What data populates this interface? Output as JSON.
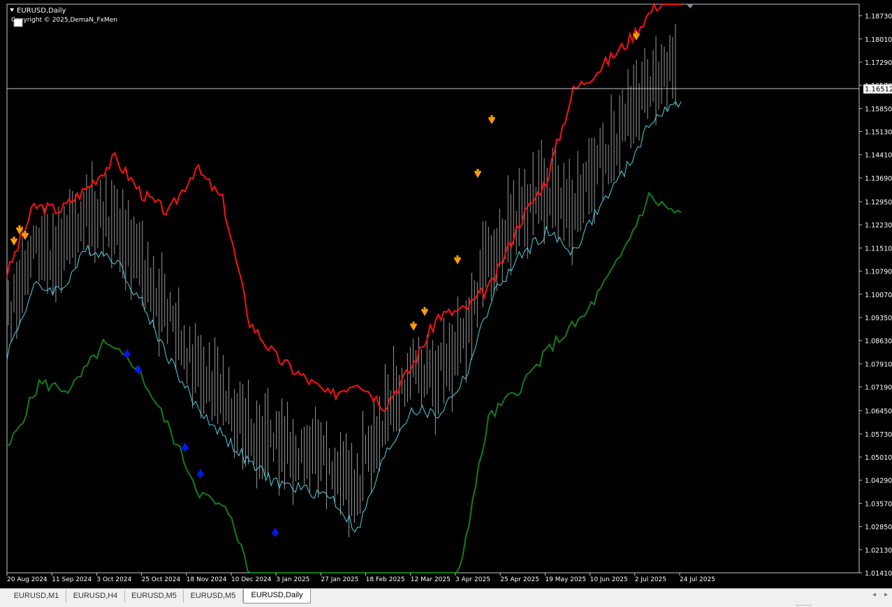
{
  "window": {
    "symbol_label": "EURUSD,Daily",
    "copyright": "Copyright © 2025,DemaN_FxMen"
  },
  "price_axis": {
    "labels": [
      "1.18730",
      "1.18010",
      "1.17290",
      "1.16570",
      "1.15850",
      "1.15130",
      "1.14410",
      "1.13690",
      "1.12950",
      "1.12230",
      "1.11510",
      "1.10790",
      "1.10070",
      "1.09350",
      "1.08630",
      "1.07910",
      "1.07190",
      "1.06450",
      "1.05730",
      "1.05010",
      "1.04290",
      "1.03570",
      "1.02850",
      "1.02130",
      "1.01410"
    ],
    "current_price": "1.16512",
    "min": 1.0141,
    "max": 1.1909
  },
  "time_axis": {
    "labels": [
      "20 Aug 2024",
      "11 Sep 2024",
      "3 Oct 2024",
      "25 Oct 2024",
      "18 Nov 2024",
      "10 Dec 2024",
      "3 Jan 2025",
      "27 Jan 2025",
      "18 Feb 2025",
      "12 Mar 2025",
      "3 Apr 2025",
      "25 Apr 2025",
      "19 May 2025",
      "10 Jun 2025",
      "2 Jul 2025",
      "24 Jul 2025"
    ]
  },
  "chart_data": {
    "type": "line",
    "x_labels": [
      "20 Aug 2024",
      "11 Sep 2024",
      "3 Oct 2024",
      "25 Oct 2024",
      "18 Nov 2024",
      "10 Dec 2024",
      "3 Jan 2025",
      "27 Jan 2025",
      "18 Feb 2025",
      "12 Mar 2025",
      "3 Apr 2025",
      "25 Apr 2025",
      "19 May 2025",
      "10 Jun 2025",
      "2 Jul 2025",
      "24 Jul 2025"
    ],
    "ylim": [
      1.0141,
      1.1909
    ],
    "series": [
      {
        "color": "#ff1010",
        "values": [
          1.107,
          1.128,
          1.127,
          1.134,
          1.143,
          1.132,
          1.126,
          1.14,
          1.13,
          1.092,
          1.081,
          1.075,
          1.069,
          1.074,
          1.066,
          1.078,
          1.094,
          1.096,
          1.104,
          1.123,
          1.136,
          1.164,
          1.171,
          1.179,
          1.19,
          1.195
        ]
      },
      {
        "color": "#4ed4e6",
        "values": [
          1.082,
          1.103,
          1.102,
          1.115,
          1.112,
          1.098,
          1.081,
          1.066,
          1.057,
          1.048,
          1.042,
          1.04,
          1.038,
          1.027,
          1.05,
          1.065,
          1.063,
          1.075,
          1.1,
          1.112,
          1.12,
          1.114,
          1.128,
          1.14,
          1.156,
          1.16
        ]
      },
      {
        "color": "#0f7f1a",
        "values": [
          1.052,
          1.073,
          1.071,
          1.085,
          1.079,
          1.06,
          1.039,
          1.032,
          0.998,
          0.985,
          0.99,
          0.984,
          0.995,
          1.002,
          1.01,
          1.062,
          1.072,
          1.085,
          1.094,
          1.11,
          1.131,
          1.125
        ]
      }
    ],
    "marker_colors": {
      "sell": "#ffa000",
      "buy": "#0018ff"
    }
  },
  "tabs": [
    "EURUSD,M1",
    "EURUSD,H4",
    "EURUSD,M5",
    "EURUSD,M5",
    "EURUSD,Daily"
  ],
  "active_tab": "EURUSD,Daily"
}
